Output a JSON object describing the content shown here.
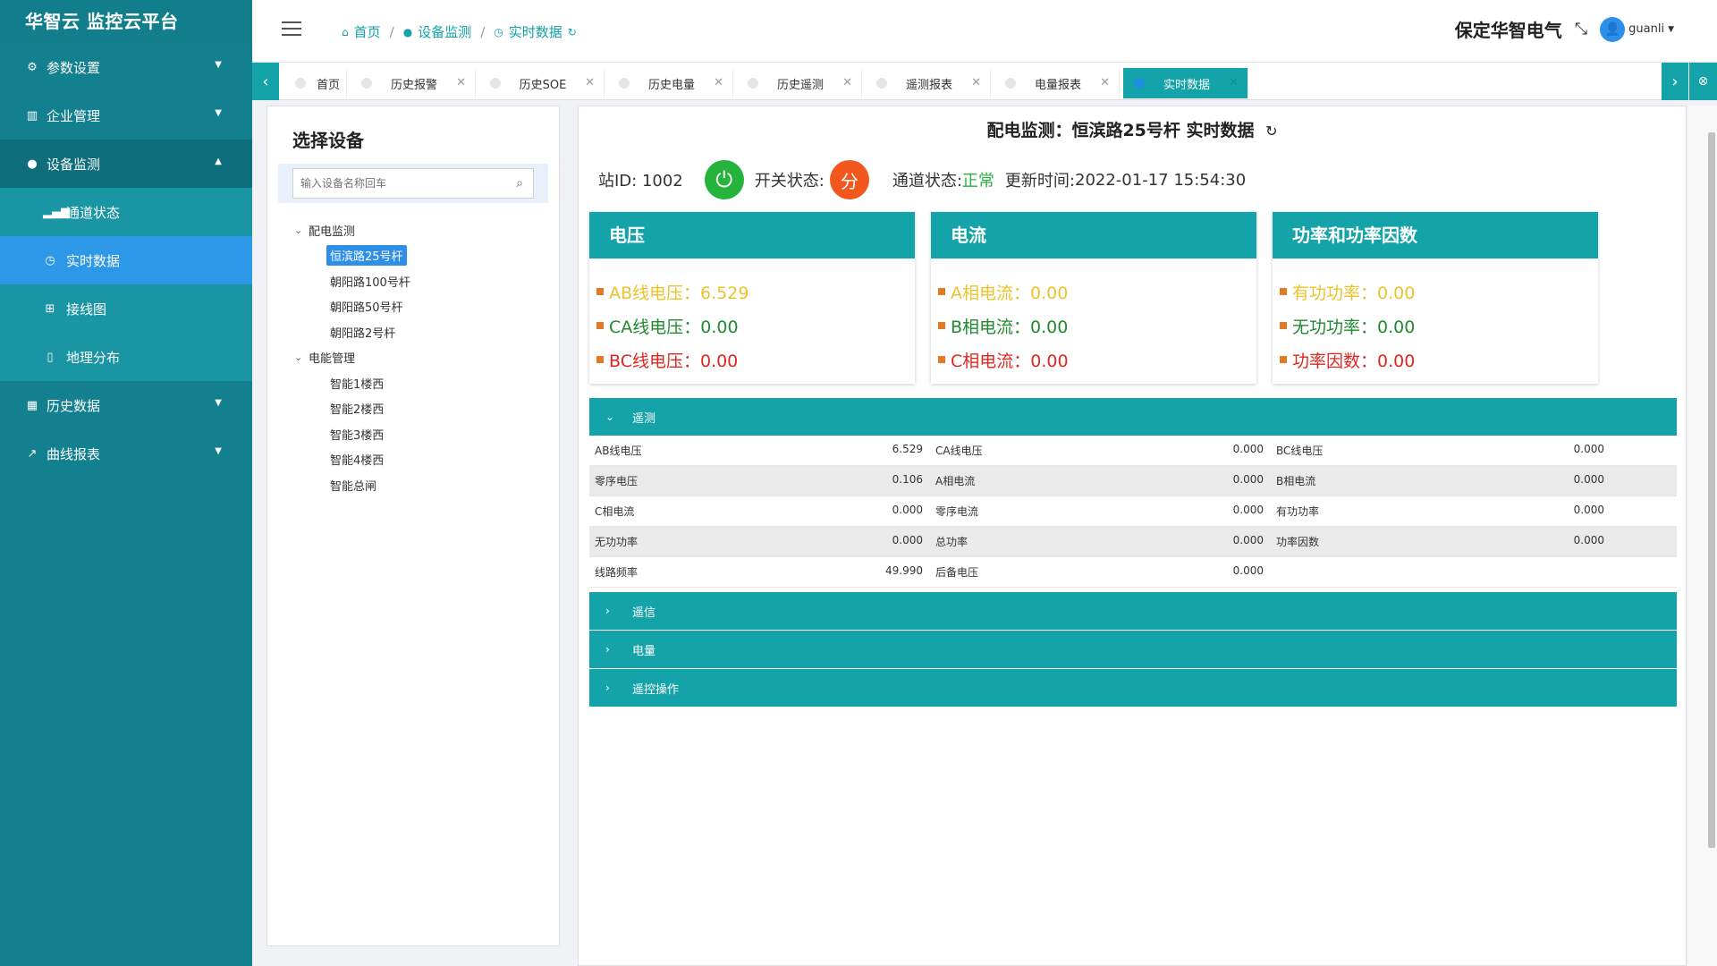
{
  "app": {
    "title": "华智云 监控云平台"
  },
  "sidebar": {
    "items": [
      {
        "label": "参数设置",
        "icon": "gear-icon"
      },
      {
        "label": "企业管理",
        "icon": "building-icon"
      },
      {
        "label": "设备监测",
        "icon": "circle-icon"
      },
      {
        "label": "历史数据",
        "icon": "table-icon"
      },
      {
        "label": "曲线报表",
        "icon": "trend-icon"
      }
    ],
    "sub_items": [
      {
        "label": "通道状态",
        "icon": "signal-icon"
      },
      {
        "label": "实时数据",
        "icon": "clock-icon"
      },
      {
        "label": "接线图",
        "icon": "sitemap-icon"
      },
      {
        "label": "地理分布",
        "icon": "map-icon"
      }
    ]
  },
  "header": {
    "breadcrumb": [
      "首页",
      "设备监测",
      "实时数据"
    ],
    "company": "保定华智电气",
    "username": "guanli"
  },
  "tabs": [
    {
      "label": "首页"
    },
    {
      "label": "历史报警"
    },
    {
      "label": "历史SOE"
    },
    {
      "label": "历史电量"
    },
    {
      "label": "历史遥测"
    },
    {
      "label": "遥测报表"
    },
    {
      "label": "电量报表"
    },
    {
      "label": "实时数据"
    }
  ],
  "device_panel": {
    "title": "选择设备",
    "search_placeholder": "输入设备名称回车",
    "groups": [
      {
        "label": "配电监测",
        "children": [
          "恒滨路25号杆",
          "朝阳路100号杆",
          "朝阳路50号杆",
          "朝阳路2号杆"
        ]
      },
      {
        "label": "电能管理",
        "children": [
          "智能1楼西",
          "智能2楼西",
          "智能3楼西",
          "智能4楼西",
          "智能总闸"
        ]
      }
    ]
  },
  "main": {
    "title": "配电监测：恒滨路25号杆 实时数据",
    "station_label": "站ID: 1002",
    "switch_label": "开关状态:",
    "switch_value": "分",
    "channel_label": "通道状态:",
    "channel_value": "正常",
    "update_label": "更新时间:",
    "update_value": "2022-01-17 15:54:30",
    "cards": [
      {
        "title": "电压",
        "lines": [
          {
            "label": "AB线电压：6.529",
            "color": "#ecc32b"
          },
          {
            "label": "CA线电压：0.00",
            "color": "#1f8a2e"
          },
          {
            "label": "BC线电压：0.00",
            "color": "#e0271f"
          }
        ]
      },
      {
        "title": "电流",
        "lines": [
          {
            "label": "A相电流：0.00",
            "color": "#ecc32b"
          },
          {
            "label": "B相电流：0.00",
            "color": "#1f8a2e"
          },
          {
            "label": "C相电流：0.00",
            "color": "#e0271f"
          }
        ]
      },
      {
        "title": "功率和功率因数",
        "lines": [
          {
            "label": "有功功率：0.00",
            "color": "#ecc32b"
          },
          {
            "label": "无功功率：0.00",
            "color": "#1f8a2e"
          },
          {
            "label": "功率因数：0.00",
            "color": "#e0271f"
          }
        ]
      }
    ],
    "telemetry": {
      "title": "遥测",
      "rows": [
        [
          [
            "AB线电压",
            "6.529"
          ],
          [
            "CA线电压",
            "0.000"
          ],
          [
            "BC线电压",
            "0.000"
          ]
        ],
        [
          [
            "零序电压",
            "0.106"
          ],
          [
            "A相电流",
            "0.000"
          ],
          [
            "B相电流",
            "0.000"
          ]
        ],
        [
          [
            "C相电流",
            "0.000"
          ],
          [
            "零序电流",
            "0.000"
          ],
          [
            "有功功率",
            "0.000"
          ]
        ],
        [
          [
            "无功功率",
            "0.000"
          ],
          [
            "总功率",
            "0.000"
          ],
          [
            "功率因数",
            "0.000"
          ]
        ],
        [
          [
            "线路频率",
            "49.990"
          ],
          [
            "后备电压",
            "0.000"
          ],
          [
            "",
            ""
          ]
        ]
      ]
    },
    "sections": [
      "遥信",
      "电量",
      "遥控操作"
    ]
  },
  "colors": {
    "sidebar": "#13808f",
    "accent": "#13a3a8",
    "active": "#2e98e8"
  }
}
